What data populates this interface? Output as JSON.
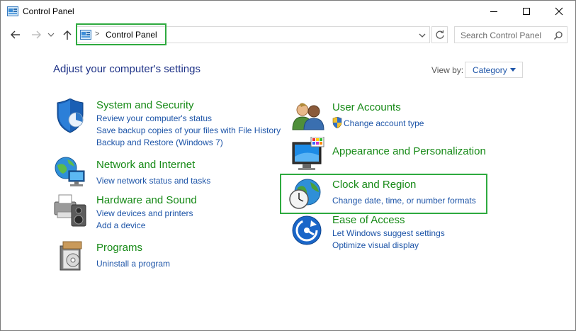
{
  "window": {
    "title": "Control Panel",
    "minimize_icon": "minimize-icon",
    "maximize_icon": "maximize-icon",
    "close_icon": "close-icon"
  },
  "address": {
    "separator": ">",
    "crumb": "Control Panel",
    "search_placeholder": "Search Control Panel"
  },
  "main": {
    "heading": "Adjust your computer's settings",
    "view_by_label": "View by:",
    "view_by_value": "Category"
  },
  "categories": {
    "system": {
      "title": "System and Security",
      "links": [
        "Review your computer's status",
        "Save backup copies of your files with File History",
        "Backup and Restore (Windows 7)"
      ],
      "icon": "shield-icon"
    },
    "network": {
      "title": "Network and Internet",
      "links": [
        "View network status and tasks"
      ],
      "icon": "network-globe-icon"
    },
    "hardware": {
      "title": "Hardware and Sound",
      "links": [
        "View devices and printers",
        "Add a device"
      ],
      "icon": "printer-speaker-icon"
    },
    "programs": {
      "title": "Programs",
      "links": [
        "Uninstall a program"
      ],
      "icon": "programs-box-icon"
    },
    "users": {
      "title": "User Accounts",
      "links": [
        "Change account type"
      ],
      "icon": "users-icon"
    },
    "appearance": {
      "title": "Appearance and Personalization",
      "links": [],
      "icon": "monitor-palette-icon"
    },
    "clock": {
      "title": "Clock and Region",
      "links": [
        "Change date, time, or number formats"
      ],
      "icon": "clock-globe-icon"
    },
    "ease": {
      "title": "Ease of Access",
      "links": [
        "Let Windows suggest settings",
        "Optimize visual display"
      ],
      "icon": "ease-of-access-icon"
    }
  },
  "colors": {
    "highlight": "#2eaa3f",
    "category_title": "#178a17",
    "link": "#1e55a8",
    "heading": "#1e3287"
  }
}
